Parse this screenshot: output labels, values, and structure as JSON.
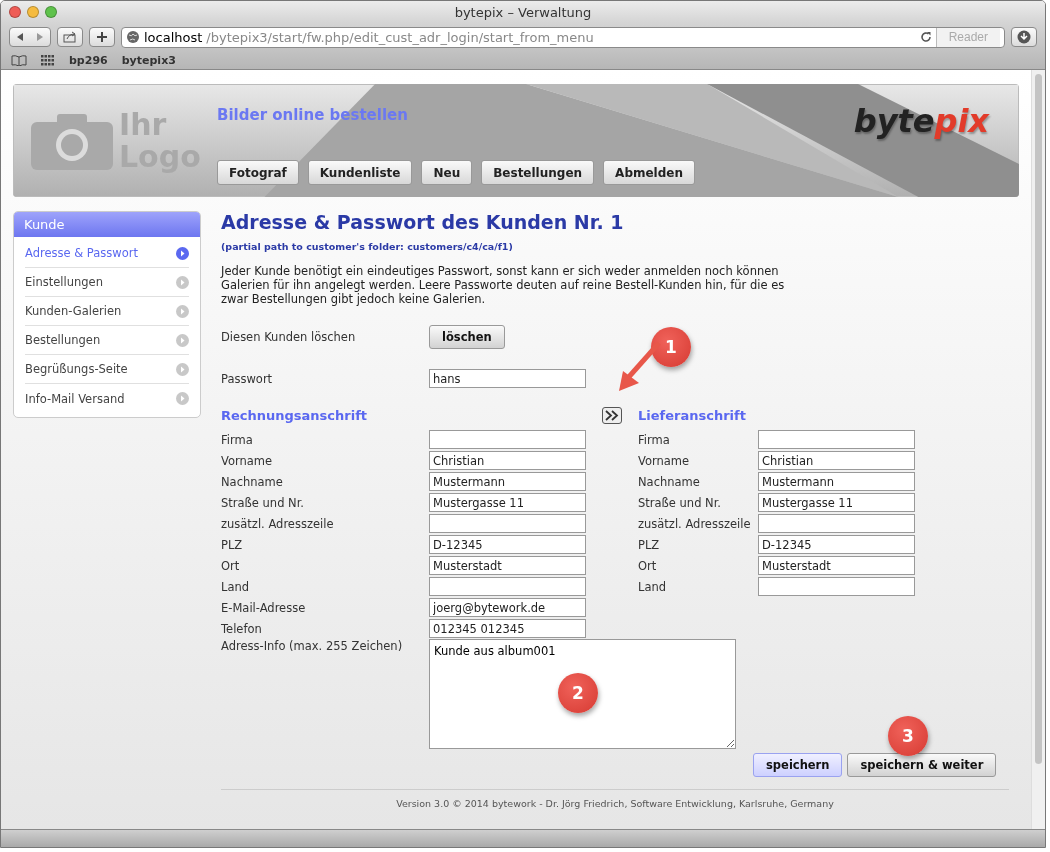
{
  "window": {
    "title": "bytepix – Verwaltung"
  },
  "toolbar": {
    "url_host": "localhost",
    "url_path": "/bytepix3/start/fw.php/edit_cust_adr_login/start_from_menu",
    "reader": "Reader"
  },
  "bookmarks": [
    "bp296",
    "bytepix3"
  ],
  "header": {
    "logo_text": [
      "Ihr",
      "Logo"
    ],
    "tagline": "Bilder online bestellen",
    "brand": [
      "byte",
      "pix"
    ],
    "nav": [
      {
        "label": "Fotograf"
      },
      {
        "label": "Kundenliste"
      },
      {
        "label": "Neu"
      },
      {
        "label": "Bestellungen"
      },
      {
        "label": "Abmelden"
      }
    ]
  },
  "sidebar": {
    "title": "Kunde",
    "items": [
      {
        "label": "Adresse & Passwort",
        "selected": true
      },
      {
        "label": "Einstellungen",
        "selected": false
      },
      {
        "label": "Kunden-Galerien",
        "selected": false
      },
      {
        "label": "Bestellungen",
        "selected": false
      },
      {
        "label": "Begrüßungs-Seite",
        "selected": false
      },
      {
        "label": "Info-Mail Versand",
        "selected": false
      }
    ]
  },
  "main": {
    "title": "Adresse & Passwort des Kunden Nr. 1",
    "path_note": "(partial path to customer's folder: customers/c4/ca/f1)",
    "intro": "Jeder Kunde benötigt ein eindeutiges Passwort, sonst kann er sich weder anmelden noch können Galerien für ihn angelegt werden. Leere Passworte deuten auf reine Bestell-Kunden hin, für die es zwar Bestellungen gibt jedoch keine Galerien.",
    "delete": {
      "label": "Diesen Kunden löschen",
      "button": "löschen"
    },
    "password": {
      "label": "Passwort",
      "value": "hans"
    },
    "billing": {
      "title": "Rechnungsanschrift",
      "fields": [
        {
          "label": "Firma"
        },
        {
          "label": "Vorname",
          "value": "Christian"
        },
        {
          "label": "Nachname",
          "value": "Mustermann"
        },
        {
          "label": "Straße und Nr.",
          "value": "Mustergasse 11"
        },
        {
          "label": "zusätzl. Adresszeile"
        },
        {
          "label": "PLZ",
          "value": "D-12345"
        },
        {
          "label": "Ort",
          "value": "Musterstadt"
        },
        {
          "label": "Land"
        },
        {
          "label": "E-Mail-Adresse",
          "value": "joerg@bytework.de"
        },
        {
          "label": "Telefon",
          "value": "012345 012345"
        }
      ]
    },
    "shipping": {
      "title": "Lieferanschrift",
      "fields": [
        {
          "label": "Firma"
        },
        {
          "label": "Vorname",
          "value": "Christian"
        },
        {
          "label": "Nachname",
          "value": "Mustermann"
        },
        {
          "label": "Straße und Nr.",
          "value": "Mustergasse 11"
        },
        {
          "label": "zusätzl. Adresszeile"
        },
        {
          "label": "PLZ",
          "value": "D-12345"
        },
        {
          "label": "Ort",
          "value": "Musterstadt"
        },
        {
          "label": "Land"
        }
      ]
    },
    "info": {
      "label": "Adress-Info (max. 255 Zeichen)",
      "value": "Kunde aus album001"
    },
    "buttons": [
      {
        "label": "speichern",
        "kind": "primary"
      },
      {
        "label": "speichern & weiter",
        "kind": "secondary"
      }
    ],
    "footer": "Version 3.0 © 2014 bytework - Dr. Jörg Friedrich, Software Entwicklung, Karlsruhe, Germany"
  },
  "callouts": [
    "1",
    "2",
    "3"
  ]
}
